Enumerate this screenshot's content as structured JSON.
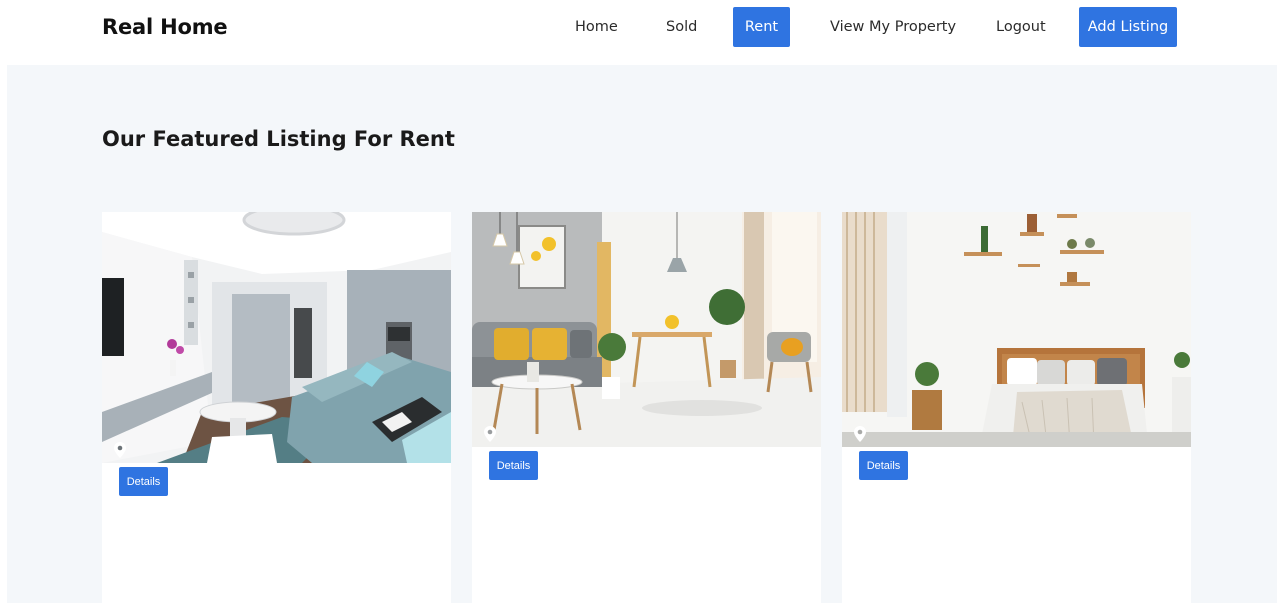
{
  "navbar": {
    "brand": "Real Home",
    "links": {
      "home": "Home",
      "sold": "Sold",
      "rent": "Rent",
      "view_my_property": "View My Property",
      "logout": "Logout",
      "add_listing": "Add Listing"
    },
    "active_link": "Rent",
    "accent_color": "#2f74e1"
  },
  "main": {
    "title": "Our Featured Listing For Rent",
    "background": "#f4f7fa",
    "cards": [
      {
        "image": "living-room-teal-sofa-photo",
        "pin_icon": "location-pin-icon",
        "button_label": "Details"
      },
      {
        "image": "living-dining-room-yellow-cushions-photo",
        "pin_icon": "location-pin-icon",
        "button_label": "Details"
      },
      {
        "image": "bedroom-wooden-bed-photo",
        "pin_icon": "location-pin-icon",
        "button_label": "Details"
      }
    ]
  }
}
